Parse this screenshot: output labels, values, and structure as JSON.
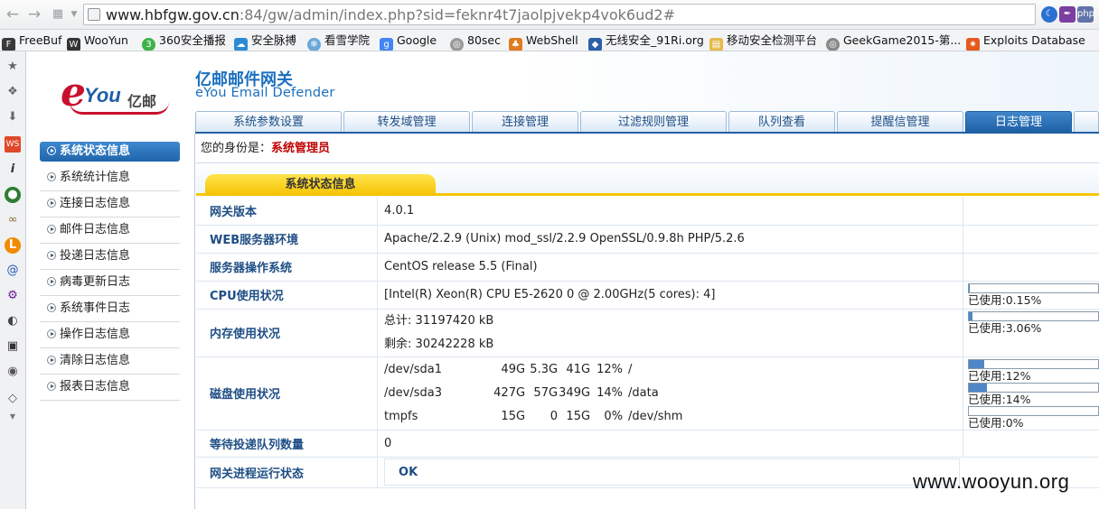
{
  "browser": {
    "url_host": "www.hbfgw.gov.cn",
    "url_rest": ":84/gw/admin/index.php?sid=feknr4t7jaolpjvekp4vok6ud2#",
    "bookmarks": [
      "FreeBuf",
      "WooYun",
      "360安全播报",
      "安全脉搏",
      "看雪学院",
      "Google",
      "80sec",
      "WebShell",
      "无线安全_91Ri.org",
      "移动安全检测平台",
      "GeekGame2015-第...",
      "Exploits Database"
    ]
  },
  "header": {
    "logo_text": "eYou亿邮",
    "product_cn": "亿邮邮件网关",
    "product_en": "eYou Email Defender"
  },
  "tabs": [
    "系统参数设置",
    "转发域管理",
    "连接管理",
    "过滤规则管理",
    "队列查看",
    "提醒信管理",
    "日志管理"
  ],
  "active_tab_index": 6,
  "left_nav": [
    "系统状态信息",
    "系统统计信息",
    "连接日志信息",
    "邮件日志信息",
    "投递日志信息",
    "病毒更新日志",
    "系统事件日志",
    "操作日志信息",
    "清除日志信息",
    "报表日志信息"
  ],
  "identity": {
    "prefix": "您的身份是：",
    "role": "系统管理员"
  },
  "section_title": "系统状态信息",
  "status": {
    "gateway_version": {
      "label": "网关版本",
      "value": "4.0.1"
    },
    "web_env": {
      "label": "WEB服务器环境",
      "value": "Apache/2.2.9 (Unix) mod_ssl/2.2.9 OpenSSL/0.9.8h PHP/5.2.6"
    },
    "os": {
      "label": "服务器操作系统",
      "value": "CentOS release 5.5 (Final)"
    },
    "cpu": {
      "label": "CPU使用状况",
      "value": "[Intel(R) Xeon(R) CPU E5-2620 0 @ 2.00GHz(5 cores): 4]",
      "used_label": "已使用:0.15%",
      "used_percent": 0.15
    },
    "memory": {
      "label": "内存使用状况",
      "total": "总计: 31197420 kB",
      "free": "剩余: 30242228 kB",
      "used_label": "已使用:3.06%",
      "used_percent": 3.06
    },
    "disk": {
      "label": "磁盘使用状况",
      "rows": [
        {
          "dev": "/dev/sda1",
          "size": "49G",
          "used": "5.3G",
          "avail": "41G",
          "pct": "12%",
          "mount": "/",
          "used_label": "已使用:12%",
          "used_percent": 12
        },
        {
          "dev": "/dev/sda3",
          "size": "427G",
          "used": "57G",
          "avail": "349G",
          "pct": "14%",
          "mount": "/data",
          "used_label": "已使用:14%",
          "used_percent": 14
        },
        {
          "dev": "tmpfs",
          "size": "15G",
          "used": "0",
          "avail": "15G",
          "pct": "0%",
          "mount": "/dev/shm",
          "used_label": "已使用:0%",
          "used_percent": 0
        }
      ]
    },
    "queue": {
      "label": "等待投递队列数量",
      "value": "0"
    },
    "process": {
      "label": "网关进程运行状态",
      "value": "OK"
    }
  },
  "watermark": "www.wooyun.org",
  "colors": {
    "brand_blue": "#1e5fa4",
    "label_blue": "#1f4e85",
    "role_red": "#c00000",
    "section_yellow": "#f5c200",
    "meter_fill": "#4f87c9"
  }
}
